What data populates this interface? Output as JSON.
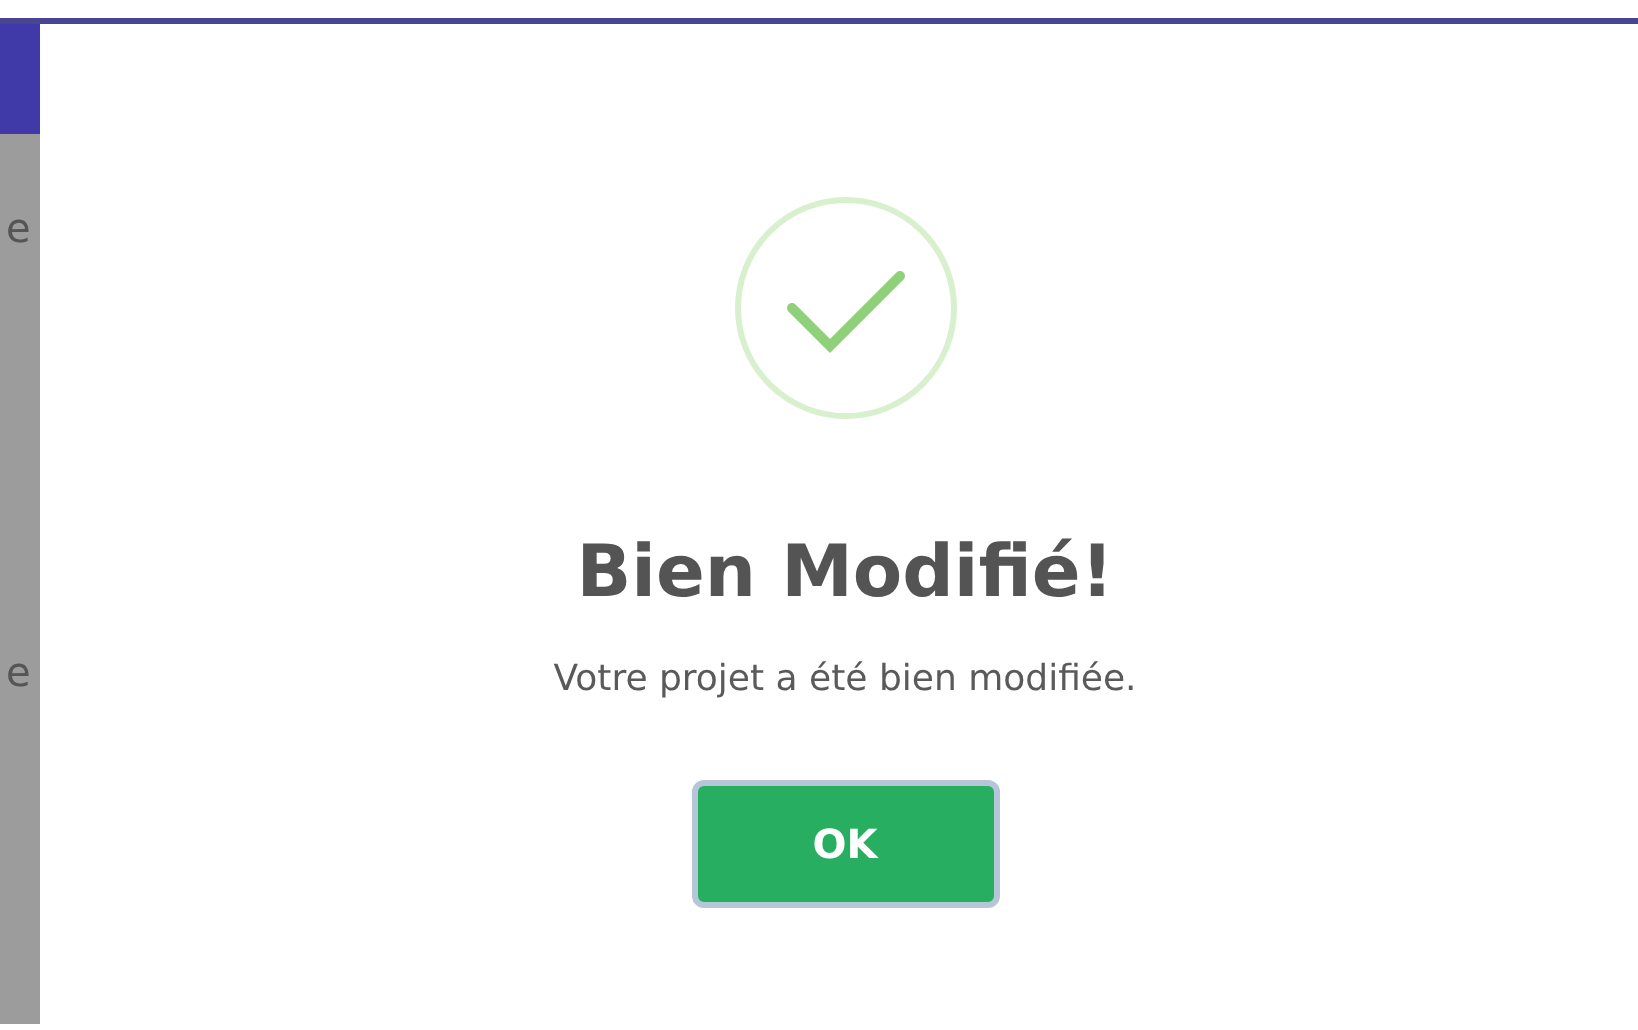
{
  "background": {
    "fragments": [
      "e",
      "e"
    ]
  },
  "dialog": {
    "icon": {
      "kind": "success"
    },
    "title": "Bien Modifié!",
    "message": "Votre projet a été bien modifiée.",
    "buttons": [
      {
        "label": "OK",
        "focused": true
      }
    ]
  }
}
